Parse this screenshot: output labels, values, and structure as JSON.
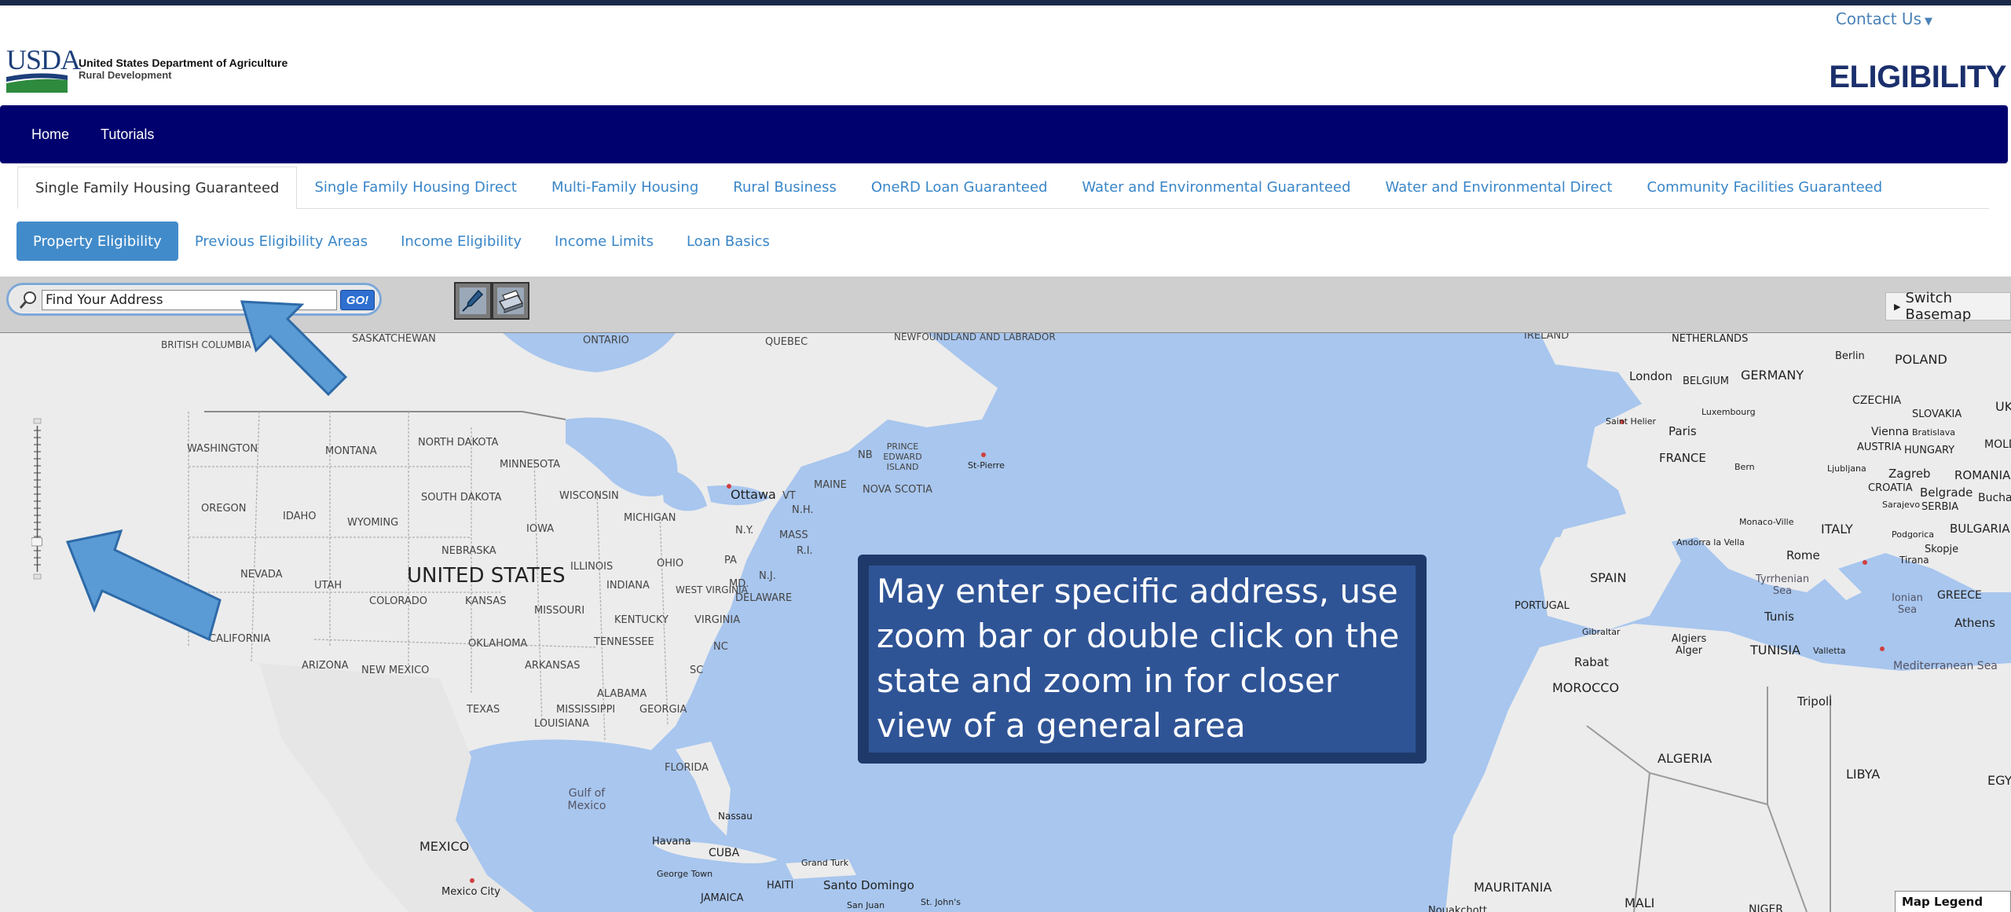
{
  "header": {
    "contact_label": "Contact Us",
    "logo_abbrev": "USDA",
    "logo_line1": "United States Department of Agriculture",
    "logo_line2": "Rural Development",
    "page_title": "ELIGIBILITY"
  },
  "navbar": {
    "items": [
      {
        "label": "Home"
      },
      {
        "label": "Tutorials"
      }
    ]
  },
  "program_tabs": [
    {
      "label": "Single Family Housing Guaranteed",
      "active": true
    },
    {
      "label": "Single Family Housing Direct"
    },
    {
      "label": "Multi-Family Housing"
    },
    {
      "label": "Rural Business"
    },
    {
      "label": "OneRD Loan Guaranteed"
    },
    {
      "label": "Water and Environmental Guaranteed"
    },
    {
      "label": "Water and Environmental Direct"
    },
    {
      "label": "Community Facilities Guaranteed"
    }
  ],
  "sub_tabs": [
    {
      "label": "Property Eligibility",
      "active": true
    },
    {
      "label": "Previous Eligibility Areas"
    },
    {
      "label": "Income Eligibility"
    },
    {
      "label": "Income Limits"
    },
    {
      "label": "Loan Basics"
    }
  ],
  "toolbar": {
    "search_value": "Find Your Address",
    "go_label": "GO!",
    "switch_basemap_label": "Switch Basemap"
  },
  "map": {
    "labels": {
      "british_columbia": "BRITISH COLUMBIA",
      "saskatchewan": "SASKATCHEWAN",
      "ontario": "ONTARIO",
      "quebec": "QUEBEC",
      "newfoundland": "NEWFOUNDLAND AND LABRADOR",
      "washington": "WASHINGTON",
      "montana": "MONTANA",
      "north_dakota": "NORTH DAKOTA",
      "minnesota": "MINNESOTA",
      "oregon": "OREGON",
      "idaho": "IDAHO",
      "wyoming": "WYOMING",
      "south_dakota": "SOUTH DAKOTA",
      "wisconsin": "WISCONSIN",
      "michigan": "MICHIGAN",
      "nebraska": "NEBRASKA",
      "iowa": "IOWA",
      "nevada": "NEVADA",
      "utah": "UTAH",
      "colorado": "COLORADO",
      "kansas": "KANSAS",
      "illinois": "ILLINOIS",
      "indiana": "INDIANA",
      "ohio": "OHIO",
      "pa": "PA",
      "united_states": "UNITED STATES",
      "missouri": "MISSOURI",
      "kentucky": "KENTUCKY",
      "west_virginia": "WEST VIRGINIA",
      "virginia": "VIRGINIA",
      "california": "CALIFORNIA",
      "oklahoma": "OKLAHOMA",
      "tennessee": "TENNESSEE",
      "nc": "NC",
      "arizona": "ARIZONA",
      "new_mexico": "NEW MEXICO",
      "arkansas": "ARKANSAS",
      "sc": "SC",
      "texas": "TEXAS",
      "mississippi": "MISSISSIPPI",
      "alabama": "ALABAMA",
      "georgia": "GEORGIA",
      "louisiana": "LOUISIANA",
      "florida": "FLORIDA",
      "gulf": "Gulf of Mexico",
      "mexico": "MEXICO",
      "mexico_city": "Mexico City",
      "havana": "Havana",
      "cuba": "CUBA",
      "nassau": "Nassau",
      "george_town": "George Town",
      "grand_turk": "Grand Turk",
      "haiti": "HAITI",
      "santo_domingo": "Santo Domingo",
      "jamaica": "JAMAICA",
      "san_juan": "San Juan",
      "st_johns": "St. John's",
      "ottawa": "Ottawa",
      "vt": "VT",
      "nh": "N.H.",
      "ny": "N.Y.",
      "mass": "MASS",
      "ri": "R.I.",
      "maine": "MAINE",
      "md": "MD.",
      "nj": "N.J.",
      "delaware": "DELAWARE",
      "nb": "NB",
      "pei": "PRINCE EDWARD ISLAND",
      "nova_scotia": "NOVA SCOTIA",
      "st_pierre": "St-Pierre",
      "ireland": "IRELAND",
      "netherlands": "NETHERLANDS",
      "berlin": "Berlin",
      "poland": "POLAND",
      "london": "London",
      "belgium": "BELGIUM",
      "germany": "GERMANY",
      "uk": "UK",
      "czechia": "CZECHIA",
      "luxembourg": "Luxembourg",
      "saint_helier": "Saint Helier",
      "paris": "Paris",
      "slovakia": "SLOVAKIA",
      "vienna": "Vienna",
      "bratislava": "Bratislava",
      "austria": "AUSTRIA",
      "hungary": "HUNGARY",
      "moldova": "MOLDO",
      "france": "FRANCE",
      "bern": "Bern",
      "ljubljana": "Ljubljana",
      "zagreb": "Zagreb",
      "romania": "ROMANIA",
      "croatia": "CROATIA",
      "belgrade": "Belgrade",
      "bucharest": "Buchar",
      "sarajevo": "Sarajevo",
      "serbia": "SERBIA",
      "monaco": "Monaco-Ville",
      "italy": "ITALY",
      "podgorica": "Podgorica",
      "bulgaria": "BULGARIA",
      "andorra": "Andorra la Vella",
      "rome": "Rome",
      "tirana": "Tirana",
      "skopje": "Skopje",
      "spain": "SPAIN",
      "tyrrhenian": "Tyrrhenian Sea",
      "ionian": "Ionian Sea",
      "greece": "GREECE",
      "athens": "Athens",
      "portugal": "PORTUGAL",
      "gibraltar": "Gibraltar",
      "tunis": "Tunis",
      "algiers": "Algiers Alger",
      "tunisia": "TUNISIA",
      "valletta": "Valletta",
      "mediterranean": "Mediterranean Sea",
      "rabat": "Rabat",
      "morocco": "MOROCCO",
      "tripoli": "Tripoli",
      "algeria": "ALGERIA",
      "libya": "LIBYA",
      "egypt": "EGY",
      "mauritania": "MAURITANIA",
      "nouakchott": "Nouakchott",
      "mali": "MALI",
      "niger": "NIGER"
    },
    "callout": "May enter specific address, use zoom bar or double click on the state and zoom in for closer view of a general area",
    "legend_label": "Map Legend"
  },
  "colors": {
    "navbar": "#00006e",
    "link": "#3a86c8",
    "active_subtab": "#428bca",
    "ocean": "#a8c6ee",
    "land": "#ececec",
    "callout_bg": "#2f5496",
    "arrow": "#5b9bd5"
  },
  "icons": {
    "search": "magnifier-icon",
    "pan": "pan-tool-icon",
    "print": "printer-icon",
    "contact_caret": "caret-down-icon"
  }
}
